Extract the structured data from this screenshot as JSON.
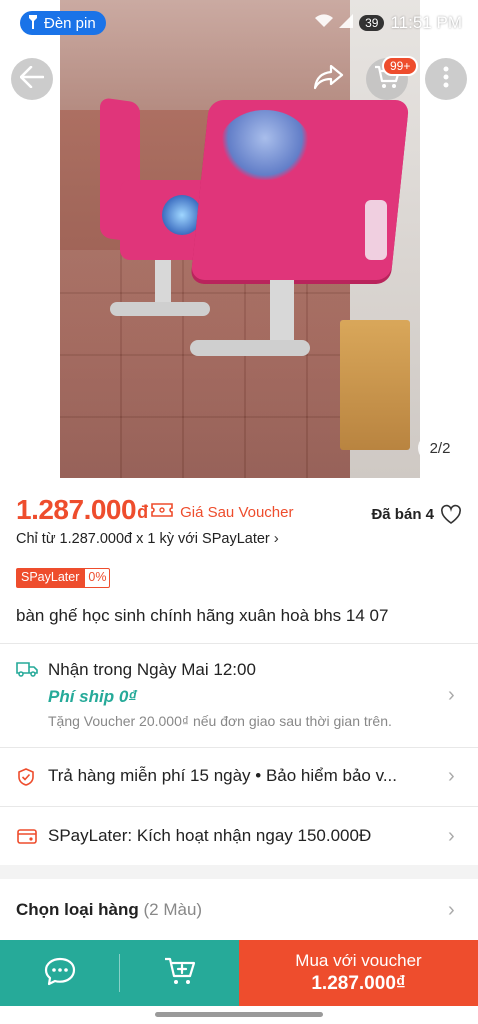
{
  "status_bar": {
    "torch_chip": "Đèn pin",
    "battery": "39",
    "time": "11:51 PM"
  },
  "header": {
    "cart_badge": "99+",
    "image_counter": "2/2"
  },
  "price": {
    "amount": "1.287.000",
    "currency": "đ",
    "voucher_label": "Giá Sau Voucher",
    "sold": "Đã bán 4"
  },
  "spaylater": {
    "installment_text": "Chỉ từ 1.287.000đ x 1 kỳ với SPayLater",
    "tag_name": "SPayLater",
    "tag_rate": "0%"
  },
  "product": {
    "title": "bàn ghế học sinh chính hãng xuân hoà bhs 14 07"
  },
  "shipping": {
    "eta": "Nhận trong Ngày Mai 12:00",
    "fee": "Phí ship 0₫",
    "note": "Tặng Voucher 20.000₫ nếu đơn giao sau thời gian trên."
  },
  "guarantee": {
    "text": "Trả hàng miễn phí 15 ngày  •  Bảo hiểm bảo v..."
  },
  "spaylater_activate": {
    "text": "SPayLater: Kích hoạt nhận ngay 150.000Đ"
  },
  "variant": {
    "label": "Chọn loại hàng",
    "count": "(2 Màu)"
  },
  "bottom_bar": {
    "buy_label": "Mua với voucher",
    "buy_price": "1.287.000₫"
  },
  "colors": {
    "brand": "#ee4d2d",
    "teal": "#26aa99"
  },
  "icons": [
    "flashlight-icon",
    "back-arrow-icon",
    "share-icon",
    "cart-icon",
    "more-vertical-icon",
    "voucher-ticket-icon",
    "heart-icon",
    "truck-icon",
    "shield-icon",
    "spaylater-icon",
    "chat-icon",
    "add-to-cart-icon",
    "chevron-right-icon"
  ]
}
